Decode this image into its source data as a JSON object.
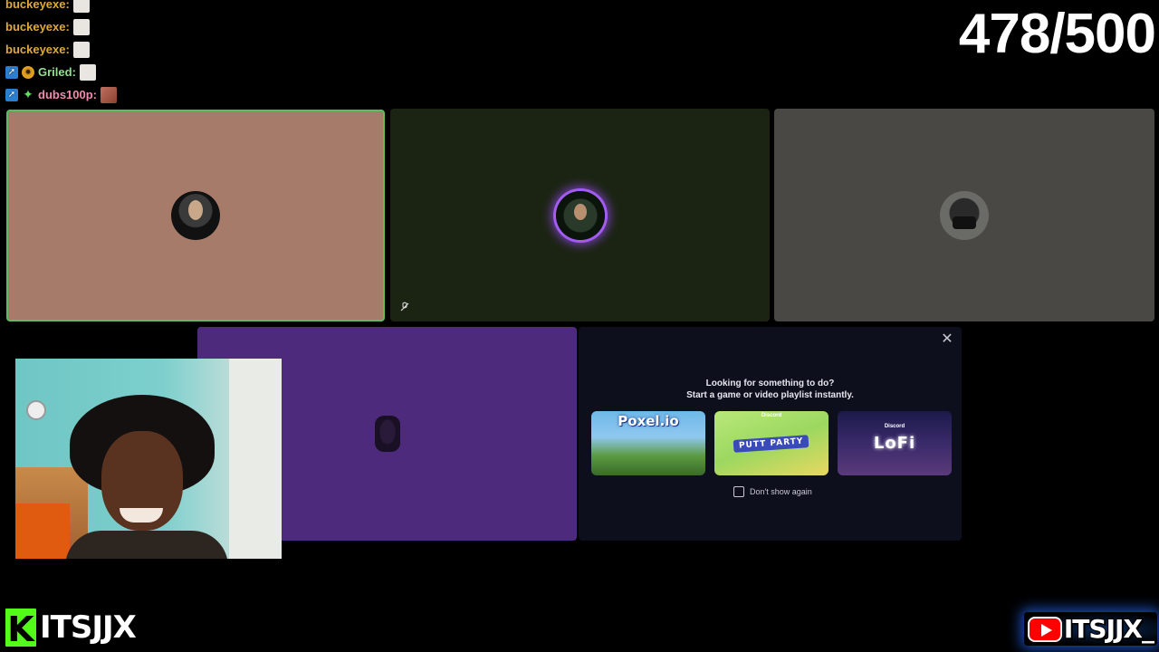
{
  "chat": [
    {
      "user": "buckeyexe:",
      "color": "gold",
      "badges": [],
      "emote": "plain"
    },
    {
      "user": "buckeyexe:",
      "color": "gold",
      "badges": [],
      "emote": "plain"
    },
    {
      "user": "buckeyexe:",
      "color": "gold",
      "badges": [],
      "emote": "plain"
    },
    {
      "user": "Griled:",
      "color": "green",
      "badges": [
        "arrow",
        "coin"
      ],
      "emote": "plain"
    },
    {
      "user": "dubs100p:",
      "color": "pink",
      "badges": [
        "arrow",
        "star"
      ],
      "emote": "face"
    }
  ],
  "counter": "478/500",
  "activity_panel": {
    "line1": "Looking for something to do?",
    "line2": "Start a game or video playlist instantly.",
    "cards": [
      {
        "label": "Poxel.io",
        "sub": ""
      },
      {
        "label": "PUTT PARTY",
        "sub": "Discord"
      },
      {
        "label": "LoFi",
        "sub": "Discord"
      }
    ],
    "checkbox_label": "Don't show again",
    "checkbox_checked": false
  },
  "brand_left": {
    "text": "ITSJJX",
    "badge": "K"
  },
  "brand_right": {
    "text": "ITSJJX_"
  },
  "colors": {
    "speaking_border": "#5bbd5b",
    "speaking_ring": "#a35cf0",
    "kick_green": "#53fc18",
    "youtube_red": "#ff0000"
  }
}
